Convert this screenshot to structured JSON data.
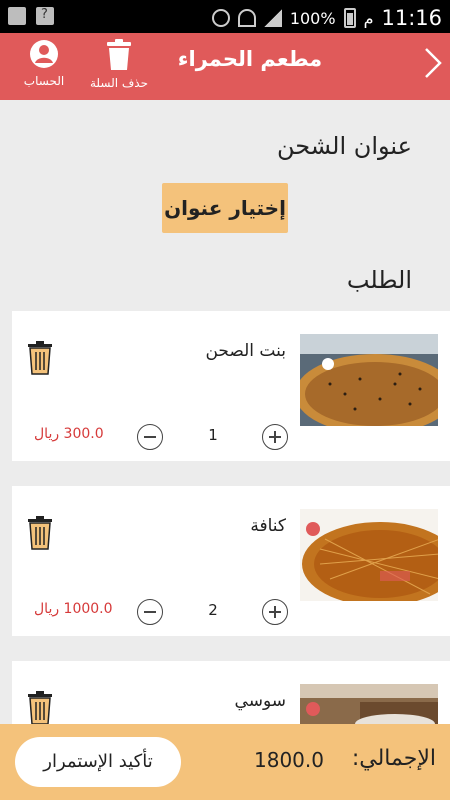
{
  "status_bar": {
    "battery": "100%",
    "ampm": "م",
    "time": "11:16"
  },
  "app_bar": {
    "title": "مطعم الحمراء",
    "account_label": "الحساب",
    "delete_cart_label": "حذف السلة"
  },
  "shipping": {
    "title": "عنوان الشحن",
    "choose_address_label": "إختيار عنوان"
  },
  "order": {
    "title": "الطلب",
    "items": [
      {
        "name": "بنت الصحن",
        "price": "300.0 ريال",
        "quantity": "1"
      },
      {
        "name": "كنافة",
        "price": "1000.0 ريال",
        "quantity": "2"
      },
      {
        "name": "سوسي",
        "price": "",
        "quantity": ""
      }
    ]
  },
  "footer": {
    "total_label": "الإجمالي:",
    "total_value": "1800.0",
    "confirm_label": "تأكيد الإستمرار"
  },
  "colors": {
    "appbar": "#e05a5a",
    "accent": "#f4c27b",
    "price": "#d63a3a",
    "background": "#ececec"
  }
}
